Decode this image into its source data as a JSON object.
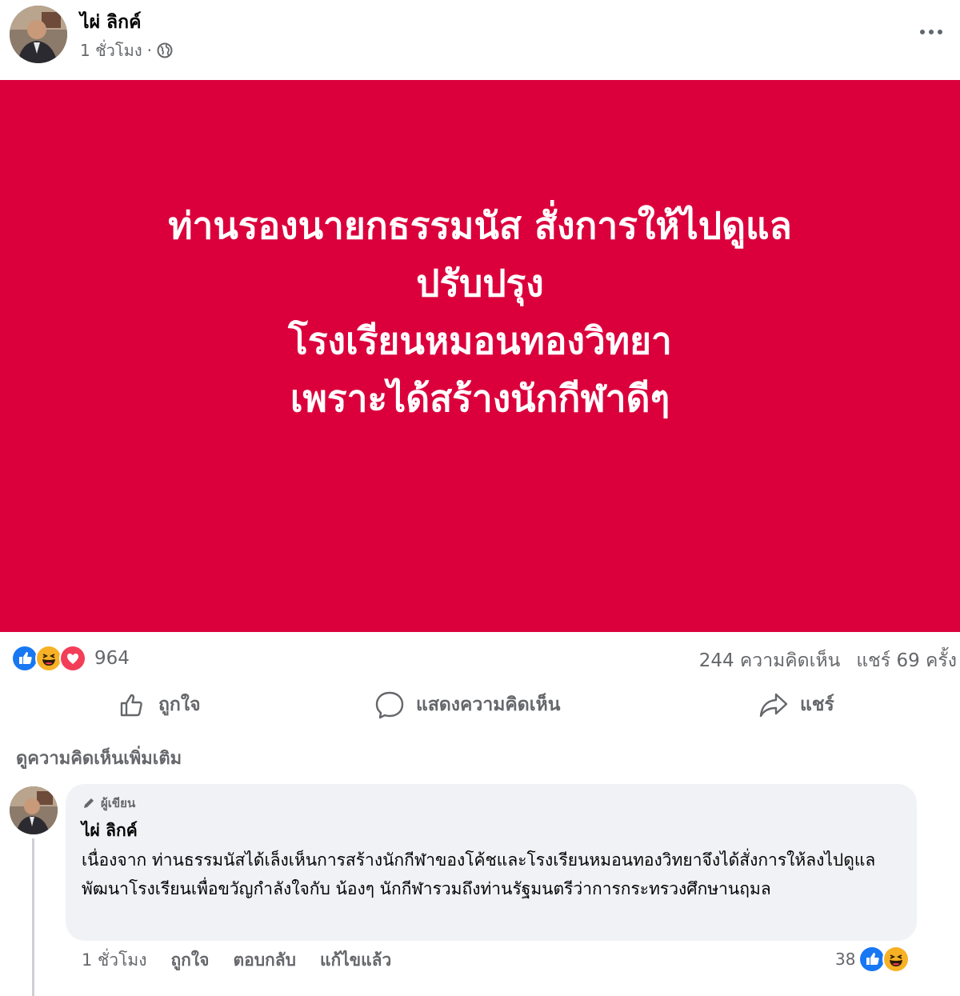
{
  "post": {
    "author": "ไผ่ ลิกค์",
    "time": "1 ชั่วโมง",
    "separator": "·",
    "privacy_icon": "globe-icon",
    "more_icon": "more-options-icon"
  },
  "card": {
    "background_color": "#db003c",
    "text_color": "#ffffff",
    "lines": [
      "ท่านรองนายกธรรมนัส สั่งการให้ไปดูแล",
      "ปรับปรุง",
      "โรงเรียนหมอนทองวิทยา",
      "เพราะได้สร้างนักกีฬาดีๆ"
    ]
  },
  "stats": {
    "reaction_icons": [
      "like-icon",
      "haha-icon",
      "love-icon"
    ],
    "reactions": "964",
    "comments": "244 ความคิดเห็น",
    "shares": "แชร์ 69 ครั้ง"
  },
  "actions": {
    "like": "ถูกใจ",
    "comment": "แสดงความคิดเห็น",
    "share": "แชร์"
  },
  "view_more_comments": "ดูความคิดเห็นเพิ่มเติม",
  "comment": {
    "badge": "ผู้เขียน",
    "author": "ไผ่ ลิกค์",
    "text": "เนื่องจาก ท่านธรรมนัสได้เล็งเห็นการสร้างนักกีฬาของโค้ชและโรงเรียนหมอนทองวิทยาจึงได้สั่งการให้ลงไปดูแลพัฒนาโรงเรียนเพื่อขวัญกำลังใจกับ น้องๆ นักกีฬารวมถึงท่านรัฐมนตรีว่าการกระทรวงศึกษานฤมล",
    "time": "1 ชั่วโมง",
    "like": "ถูกใจ",
    "reply": "ตอบกลับ",
    "edited": "แก้ไขแล้ว",
    "reaction_count": "38",
    "reaction_icons": [
      "like-icon",
      "haha-icon"
    ]
  },
  "colors": {
    "like_blue": "#1877f2",
    "haha_yellow": "#f7b125",
    "love_red": "#f33e58",
    "secondary_text": "#65676b"
  }
}
